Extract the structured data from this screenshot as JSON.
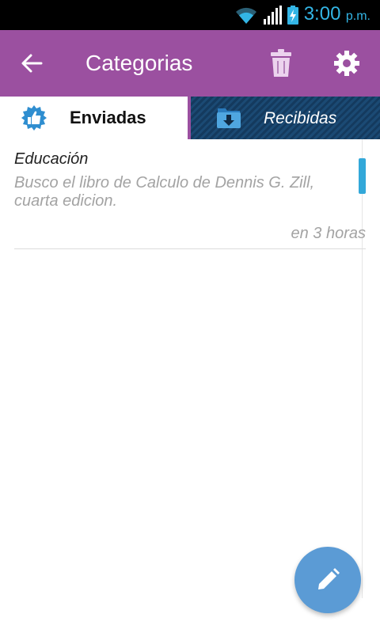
{
  "status_bar": {
    "time": "3:00",
    "ampm": "p.m.",
    "icons": [
      "wifi-icon",
      "signal-icon",
      "battery-charging-icon"
    ],
    "accent_color": "#33b5e5"
  },
  "app_bar": {
    "title": "Categorias",
    "back_icon": "arrow-left-icon",
    "actions": [
      "trash-icon",
      "gear-icon"
    ],
    "background_color": "#9b50a0"
  },
  "tabs": [
    {
      "label": "Enviadas",
      "icon": "thumbs-up-badge-icon",
      "selected": true
    },
    {
      "label": "Recibidas",
      "icon": "download-folder-icon",
      "selected": false
    }
  ],
  "items": [
    {
      "category": "Educación",
      "description": "Busco el libro de Calculo de Dennis G. Zill, cuarta edicion.",
      "time": "en 3 horas"
    }
  ],
  "fab": {
    "icon": "pencil-icon",
    "color": "#5b9bd5"
  }
}
